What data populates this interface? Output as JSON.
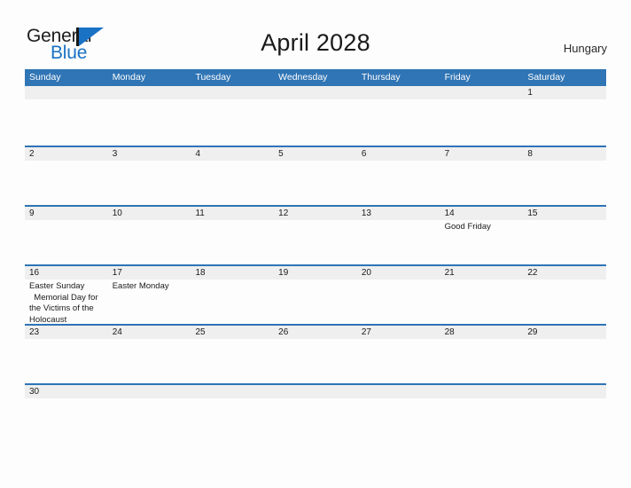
{
  "brand": {
    "word_one": "General",
    "word_two": "Blue",
    "flag_icon": "triangle-flag-icon"
  },
  "header": {
    "title": "April 2028",
    "country": "Hungary"
  },
  "calendar": {
    "weekday_headers": [
      "Sunday",
      "Monday",
      "Tuesday",
      "Wednesday",
      "Thursday",
      "Friday",
      "Saturday"
    ],
    "accent_blue": "#2e74b5",
    "header_blue": "#3075b5",
    "band_gray": "#efefef",
    "weeks": [
      [
        {
          "day": ""
        },
        {
          "day": ""
        },
        {
          "day": ""
        },
        {
          "day": ""
        },
        {
          "day": ""
        },
        {
          "day": ""
        },
        {
          "day": "1",
          "events": []
        }
      ],
      [
        {
          "day": "2",
          "events": []
        },
        {
          "day": "3",
          "events": []
        },
        {
          "day": "4",
          "events": []
        },
        {
          "day": "5",
          "events": []
        },
        {
          "day": "6",
          "events": []
        },
        {
          "day": "7",
          "events": []
        },
        {
          "day": "8",
          "events": []
        }
      ],
      [
        {
          "day": "9",
          "events": []
        },
        {
          "day": "10",
          "events": []
        },
        {
          "day": "11",
          "events": []
        },
        {
          "day": "12",
          "events": []
        },
        {
          "day": "13",
          "events": []
        },
        {
          "day": "14",
          "events": [
            "Good Friday"
          ]
        },
        {
          "day": "15",
          "events": []
        }
      ],
      [
        {
          "day": "16",
          "events": [
            "Easter Sunday\n  Memorial Day for the Victims of the Holocaust"
          ]
        },
        {
          "day": "17",
          "events": [
            "Easter Monday"
          ]
        },
        {
          "day": "18",
          "events": []
        },
        {
          "day": "19",
          "events": []
        },
        {
          "day": "20",
          "events": []
        },
        {
          "day": "21",
          "events": []
        },
        {
          "day": "22",
          "events": []
        }
      ],
      [
        {
          "day": "23",
          "events": []
        },
        {
          "day": "24",
          "events": []
        },
        {
          "day": "25",
          "events": []
        },
        {
          "day": "26",
          "events": []
        },
        {
          "day": "27",
          "events": []
        },
        {
          "day": "28",
          "events": []
        },
        {
          "day": "29",
          "events": []
        }
      ],
      [
        {
          "day": "30",
          "events": []
        },
        {
          "day": ""
        },
        {
          "day": ""
        },
        {
          "day": ""
        },
        {
          "day": ""
        },
        {
          "day": ""
        },
        {
          "day": ""
        }
      ]
    ]
  }
}
